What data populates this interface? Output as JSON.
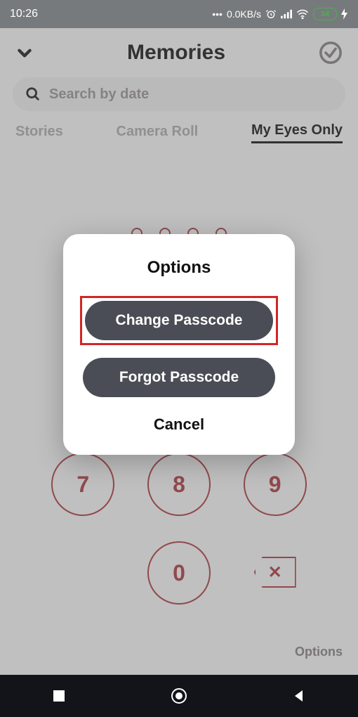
{
  "status": {
    "time": "10:26",
    "net_speed": "0.0KB/s",
    "battery": "34"
  },
  "header": {
    "title": "Memories"
  },
  "search": {
    "placeholder": "Search by date"
  },
  "tabs": {
    "stories": "Stories",
    "camera_roll": "Camera Roll",
    "my_eyes_only": "My Eyes Only"
  },
  "keypad": {
    "7": "7",
    "8": "8",
    "9": "9",
    "0": "0",
    "backspace_glyph": "✕"
  },
  "options_link": "Options",
  "modal": {
    "title": "Options",
    "change_passcode": "Change Passcode",
    "forgot_passcode": "Forgot Passcode",
    "cancel": "Cancel"
  }
}
